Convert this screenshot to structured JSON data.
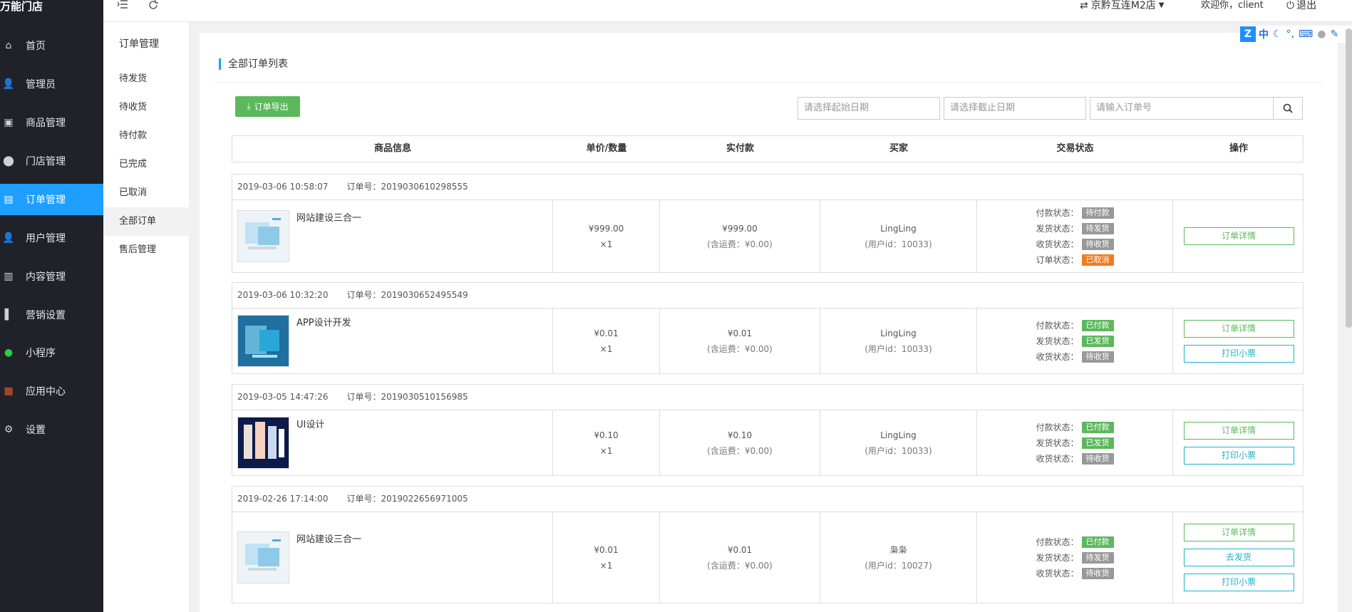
{
  "app": {
    "brand": "万能门店"
  },
  "sidebar": {
    "items": [
      {
        "label": "首页",
        "icon": "home-icon",
        "glyph": "⌂"
      },
      {
        "label": "管理员",
        "icon": "admin-user-icon",
        "glyph": "👤"
      },
      {
        "label": "商品管理",
        "icon": "gift-icon",
        "glyph": "▣"
      },
      {
        "label": "门店管理",
        "icon": "map-marker-icon",
        "glyph": "⬤"
      },
      {
        "label": "订单管理",
        "icon": "order-document-icon",
        "glyph": "▤"
      },
      {
        "label": "用户管理",
        "icon": "user-icon",
        "glyph": "👤"
      },
      {
        "label": "内容管理",
        "icon": "content-file-icon",
        "glyph": "▥"
      },
      {
        "label": "营销设置",
        "icon": "marketing-books-icon",
        "glyph": "▌"
      },
      {
        "label": "小程序",
        "icon": "mini-program-icon",
        "glyph": "●"
      },
      {
        "label": "应用中心",
        "icon": "app-grid-icon",
        "glyph": "▦"
      },
      {
        "label": "设置",
        "icon": "gear-icon",
        "glyph": "⚙"
      }
    ]
  },
  "submenu": {
    "title": "订单管理",
    "items": [
      "待发货",
      "待收货",
      "待付款",
      "已完成",
      "已取消",
      "全部订单",
      "售后管理"
    ]
  },
  "topbar": {
    "menu_icon": "menu-fold-icon",
    "refresh_icon": "refresh-icon",
    "store_switch": "京黔互连M2店",
    "welcome": "欢迎你，client",
    "logout": "退出"
  },
  "main": {
    "section_title": "全部订单列表",
    "export_label": "订单导出",
    "start_date_placeholder": "请选择起始日期",
    "end_date_placeholder": "请选择截止日期",
    "order_no_placeholder": "请输入订单号",
    "headers": [
      "商品信息",
      "单价/数量",
      "实付款",
      "买家",
      "交易状态",
      "操作"
    ]
  },
  "orders": [
    {
      "time": "2019-03-06 10:58:07",
      "order_no_label": "订单号：2019030610298555",
      "product": "网站建设三合一",
      "thumb": "web-build",
      "unit_price": "¥999.00",
      "qty": "×1",
      "paid": "¥999.00",
      "shipping": "(含运费：¥0.00)",
      "buyer": "LingLing",
      "buyer_id": "(用户id：10033)",
      "statuses": [
        {
          "label": "付款状态：",
          "value": "待付款",
          "color": "#999999"
        },
        {
          "label": "发货状态：",
          "value": "待发货",
          "color": "#999999"
        },
        {
          "label": "收货状态：",
          "value": "待收货",
          "color": "#999999"
        },
        {
          "label": "订单状态：",
          "value": "已取消",
          "color": "#f37b1d"
        }
      ],
      "actions": [
        {
          "label": "订单详情",
          "style": "green"
        }
      ]
    },
    {
      "time": "2019-03-06 10:32:20",
      "order_no_label": "订单号：2019030652495549",
      "product": "APP设计开发",
      "thumb": "app-design",
      "unit_price": "¥0.01",
      "qty": "×1",
      "paid": "¥0.01",
      "shipping": "(含运费：¥0.00)",
      "buyer": "LingLing",
      "buyer_id": "(用户id：10033)",
      "statuses": [
        {
          "label": "付款状态：",
          "value": "已付款",
          "color": "#5cb85c"
        },
        {
          "label": "发货状态：",
          "value": "已发货",
          "color": "#5cb85c"
        },
        {
          "label": "收货状态：",
          "value": "待收货",
          "color": "#999999"
        }
      ],
      "actions": [
        {
          "label": "订单详情",
          "style": "green"
        },
        {
          "label": "打印小票",
          "style": "cyan"
        }
      ]
    },
    {
      "time": "2019-03-05 14:47:26",
      "order_no_label": "订单号：2019030510156985",
      "product": "UI设计",
      "thumb": "ui-design",
      "unit_price": "¥0.10",
      "qty": "×1",
      "paid": "¥0.10",
      "shipping": "(含运费：¥0.00)",
      "buyer": "LingLing",
      "buyer_id": "(用户id：10033)",
      "statuses": [
        {
          "label": "付款状态：",
          "value": "已付款",
          "color": "#5cb85c"
        },
        {
          "label": "发货状态：",
          "value": "已发货",
          "color": "#5cb85c"
        },
        {
          "label": "收货状态：",
          "value": "待收货",
          "color": "#999999"
        }
      ],
      "actions": [
        {
          "label": "订单详情",
          "style": "green"
        },
        {
          "label": "打印小票",
          "style": "cyan"
        }
      ]
    },
    {
      "time": "2019-02-26 17:14:00",
      "order_no_label": "订单号：2019022656971005",
      "product": "网站建设三合一",
      "thumb": "web-build",
      "unit_price": "¥0.01",
      "qty": "×1",
      "paid": "¥0.01",
      "shipping": "(含运费：¥0.00)",
      "buyer": "枭枭",
      "buyer_id": "(用户id：10027)",
      "statuses": [
        {
          "label": "付款状态：",
          "value": "已付款",
          "color": "#5cb85c"
        },
        {
          "label": "发货状态：",
          "value": "待发货",
          "color": "#999999"
        },
        {
          "label": "收货状态：",
          "value": "待收货",
          "color": "#999999"
        }
      ],
      "actions": [
        {
          "label": "订单详情",
          "style": "green"
        },
        {
          "label": "去发货",
          "style": "cyan"
        },
        {
          "label": "打印小票",
          "style": "cyan"
        }
      ]
    }
  ],
  "ime_toolbar": {
    "lang": "中"
  }
}
